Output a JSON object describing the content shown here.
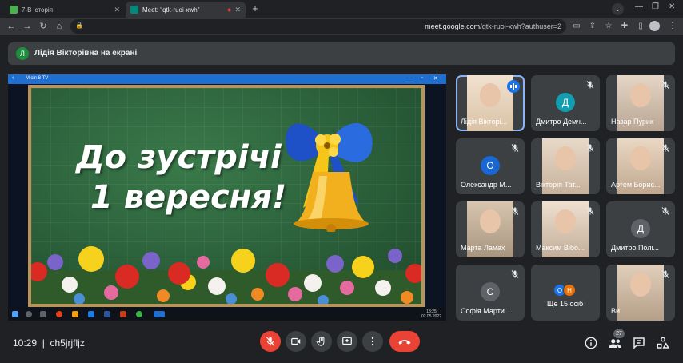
{
  "browser": {
    "tabs": [
      {
        "title": "7-В історія",
        "favicon_color": "#4caf50"
      },
      {
        "title": "Meet: \"qtk-ruoi-xwh\"",
        "favicon_color": "#00897b"
      }
    ],
    "new_tab_label": "+",
    "url_host": "meet.google.com",
    "url_path": "/qtk-ruoi-xwh?authuser=2"
  },
  "presenter_banner": {
    "avatar_letter": "Л",
    "text": "Лідія Вікторівна на екрані"
  },
  "shared_screen": {
    "app_title": "Місія 8 TV",
    "slide_line1": "До зустрічі",
    "slide_line2": "1 вересня!",
    "taskbar_time": "13:25",
    "taskbar_date": "02.05.2022"
  },
  "participants": [
    {
      "name": "Лідія Вікторі...",
      "type": "video",
      "speaking": true
    },
    {
      "name": "Дмитро Демч...",
      "type": "avatar",
      "letter": "Д",
      "color": "#129eaf"
    },
    {
      "name": "Назар Пурик",
      "type": "video"
    },
    {
      "name": "Олександр М...",
      "type": "avatar",
      "letter": "О",
      "color": "#1967d2"
    },
    {
      "name": "Вікторія Тат...",
      "type": "video"
    },
    {
      "name": "Артем Борис...",
      "type": "video"
    },
    {
      "name": "Марта Ламах",
      "type": "video"
    },
    {
      "name": "Максим Вібо...",
      "type": "video"
    },
    {
      "name": "Дмитро Полі...",
      "type": "avatar",
      "letter": "Д",
      "color": "#5f6368"
    },
    {
      "name": "Софія Марти...",
      "type": "avatar",
      "letter": "С",
      "color": "#5f6368"
    },
    {
      "name": "Ще 15 осіб",
      "type": "more",
      "letters": [
        "О",
        "Н"
      ],
      "colors": [
        "#1a73e8",
        "#e8710a"
      ]
    },
    {
      "name": "Ви",
      "type": "video"
    }
  ],
  "bottom_bar": {
    "time": "10:29",
    "meeting_code": "ch5jrjfljz",
    "participant_count": "27"
  },
  "colors": {
    "end_call": "#ea4335",
    "accent": "#8ab4f8",
    "tile_bg": "#3c4043"
  }
}
